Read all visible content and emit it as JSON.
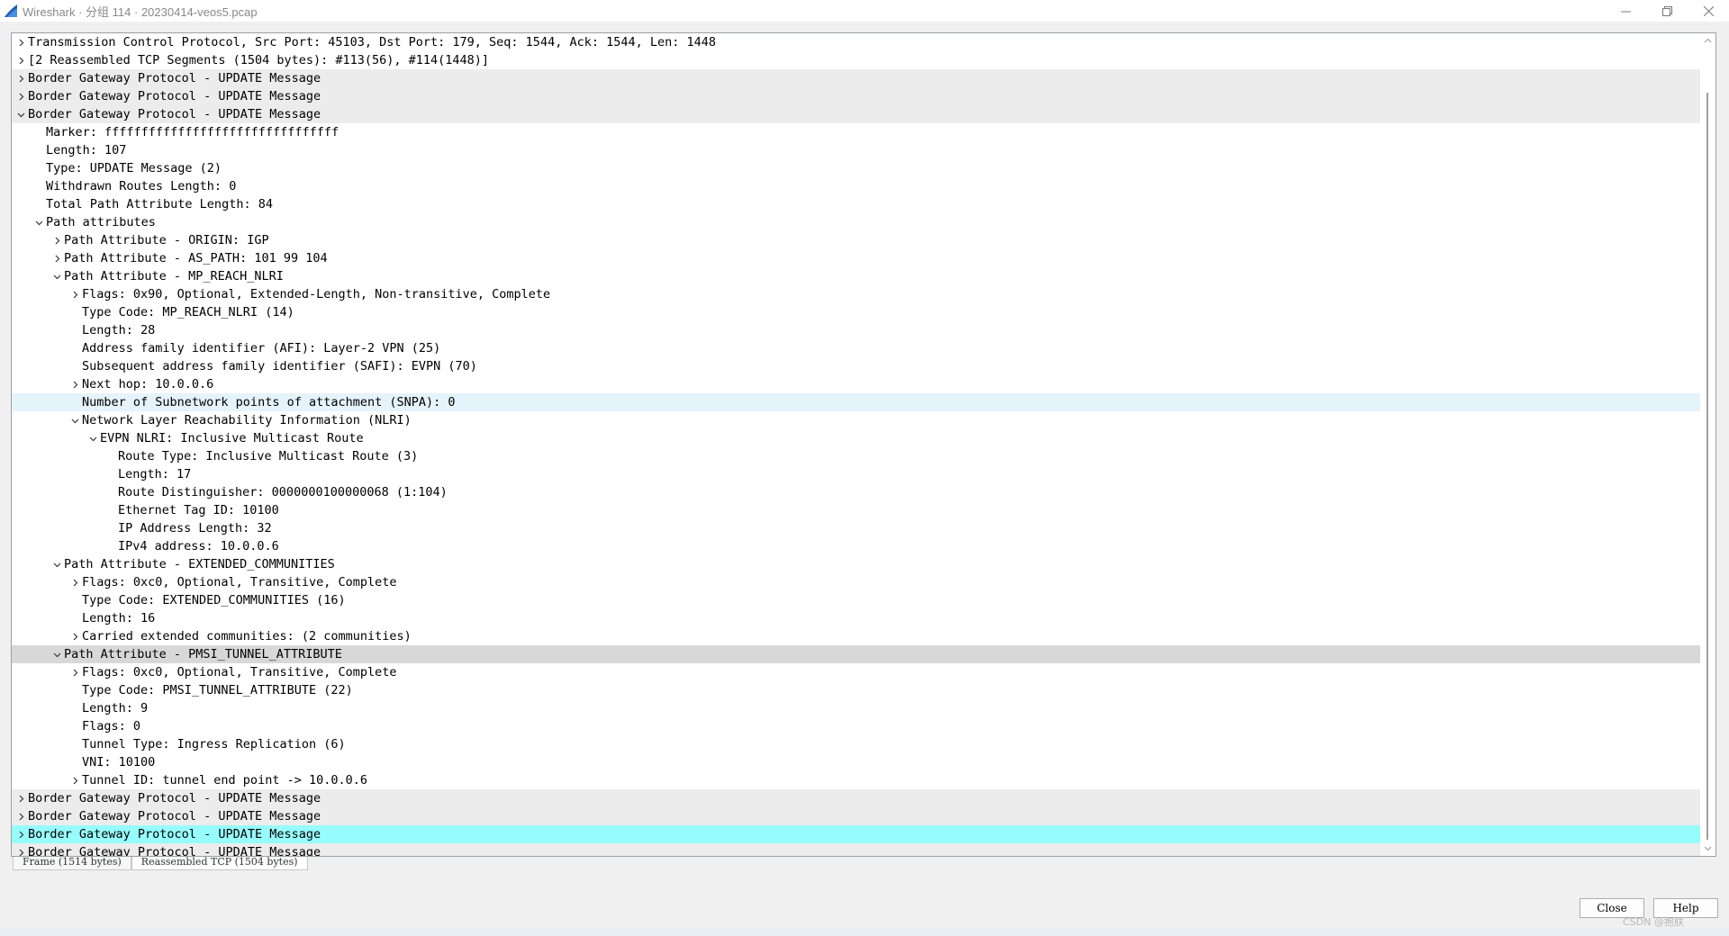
{
  "window": {
    "title": "Wireshark · 分组 114 · 20230414-veos5.pcap"
  },
  "tree": [
    {
      "level": 0,
      "expander": "collapsed",
      "text": "Transmission Control Protocol, Src Port: 45103, Dst Port: 179, Seq: 1544, Ack: 1544, Len: 1448",
      "bg": ""
    },
    {
      "level": 0,
      "expander": "collapsed",
      "text": "[2 Reassembled TCP Segments (1504 bytes): #113(56), #114(1448)]",
      "bg": ""
    },
    {
      "level": 0,
      "expander": "collapsed",
      "text": "Border Gateway Protocol - UPDATE Message",
      "bg": "grey"
    },
    {
      "level": 0,
      "expander": "collapsed",
      "text": "Border Gateway Protocol - UPDATE Message",
      "bg": "grey"
    },
    {
      "level": 0,
      "expander": "expanded",
      "text": "Border Gateway Protocol - UPDATE Message",
      "bg": "grey"
    },
    {
      "level": 1,
      "expander": "none",
      "text": "Marker: ffffffffffffffffffffffffffffffff",
      "bg": ""
    },
    {
      "level": 1,
      "expander": "none",
      "text": "Length: 107",
      "bg": ""
    },
    {
      "level": 1,
      "expander": "none",
      "text": "Type: UPDATE Message (2)",
      "bg": ""
    },
    {
      "level": 1,
      "expander": "none",
      "text": "Withdrawn Routes Length: 0",
      "bg": ""
    },
    {
      "level": 1,
      "expander": "none",
      "text": "Total Path Attribute Length: 84",
      "bg": ""
    },
    {
      "level": 1,
      "expander": "expanded",
      "text": "Path attributes",
      "bg": ""
    },
    {
      "level": 2,
      "expander": "collapsed",
      "text": "Path Attribute - ORIGIN: IGP",
      "bg": ""
    },
    {
      "level": 2,
      "expander": "collapsed",
      "text": "Path Attribute - AS_PATH: 101 99 104",
      "bg": ""
    },
    {
      "level": 2,
      "expander": "expanded",
      "text": "Path Attribute - MP_REACH_NLRI",
      "bg": ""
    },
    {
      "level": 3,
      "expander": "collapsed",
      "text": "Flags: 0x90, Optional, Extended-Length, Non-transitive, Complete",
      "bg": ""
    },
    {
      "level": 3,
      "expander": "none",
      "text": "Type Code: MP_REACH_NLRI (14)",
      "bg": ""
    },
    {
      "level": 3,
      "expander": "none",
      "text": "Length: 28",
      "bg": ""
    },
    {
      "level": 3,
      "expander": "none",
      "text": "Address family identifier (AFI): Layer-2 VPN (25)",
      "bg": ""
    },
    {
      "level": 3,
      "expander": "none",
      "text": "Subsequent address family identifier (SAFI): EVPN (70)",
      "bg": ""
    },
    {
      "level": 3,
      "expander": "collapsed",
      "text": "Next hop: 10.0.0.6",
      "bg": ""
    },
    {
      "level": 3,
      "expander": "none",
      "text": "Number of Subnetwork points of attachment (SNPA): 0",
      "bg": "hover"
    },
    {
      "level": 3,
      "expander": "expanded",
      "text": "Network Layer Reachability Information (NLRI)",
      "bg": ""
    },
    {
      "level": 4,
      "expander": "expanded",
      "text": "EVPN NLRI: Inclusive Multicast Route",
      "bg": ""
    },
    {
      "level": 5,
      "expander": "none",
      "text": "Route Type: Inclusive Multicast Route (3)",
      "bg": ""
    },
    {
      "level": 5,
      "expander": "none",
      "text": "Length: 17",
      "bg": ""
    },
    {
      "level": 5,
      "expander": "none",
      "text": "Route Distinguisher: 0000000100000068 (1:104)",
      "bg": ""
    },
    {
      "level": 5,
      "expander": "none",
      "text": "Ethernet Tag ID: 10100",
      "bg": ""
    },
    {
      "level": 5,
      "expander": "none",
      "text": "IP Address Length: 32",
      "bg": ""
    },
    {
      "level": 5,
      "expander": "none",
      "text": "IPv4 address: 10.0.0.6",
      "bg": ""
    },
    {
      "level": 2,
      "expander": "expanded",
      "text": "Path Attribute - EXTENDED_COMMUNITIES",
      "bg": ""
    },
    {
      "level": 3,
      "expander": "collapsed",
      "text": "Flags: 0xc0, Optional, Transitive, Complete",
      "bg": ""
    },
    {
      "level": 3,
      "expander": "none",
      "text": "Type Code: EXTENDED_COMMUNITIES (16)",
      "bg": ""
    },
    {
      "level": 3,
      "expander": "none",
      "text": "Length: 16",
      "bg": ""
    },
    {
      "level": 3,
      "expander": "collapsed",
      "text": "Carried extended communities: (2 communities)",
      "bg": ""
    },
    {
      "level": 2,
      "expander": "expanded",
      "text": "Path Attribute - PMSI_TUNNEL_ATTRIBUTE",
      "bg": "selected"
    },
    {
      "level": 3,
      "expander": "collapsed",
      "text": "Flags: 0xc0, Optional, Transitive, Complete",
      "bg": ""
    },
    {
      "level": 3,
      "expander": "none",
      "text": "Type Code: PMSI_TUNNEL_ATTRIBUTE (22)",
      "bg": ""
    },
    {
      "level": 3,
      "expander": "none",
      "text": "Length: 9",
      "bg": ""
    },
    {
      "level": 3,
      "expander": "none",
      "text": "Flags: 0",
      "bg": ""
    },
    {
      "level": 3,
      "expander": "none",
      "text": "Tunnel Type: Ingress Replication (6)",
      "bg": ""
    },
    {
      "level": 3,
      "expander": "none",
      "text": "VNI: 10100",
      "bg": ""
    },
    {
      "level": 3,
      "expander": "collapsed",
      "text": "Tunnel ID: tunnel end point -> 10.0.0.6",
      "bg": ""
    },
    {
      "level": 0,
      "expander": "collapsed",
      "text": "Border Gateway Protocol - UPDATE Message",
      "bg": "grey"
    },
    {
      "level": 0,
      "expander": "collapsed",
      "text": "Border Gateway Protocol - UPDATE Message",
      "bg": "grey"
    },
    {
      "level": 0,
      "expander": "collapsed",
      "text": "Border Gateway Protocol - UPDATE Message",
      "bg": "cyan"
    },
    {
      "level": 0,
      "expander": "collapsed",
      "text": "Border Gateway Protocol - UPDATE Message",
      "bg": "grey"
    }
  ],
  "tabs": [
    {
      "label": "Frame (1514 bytes)",
      "active": false
    },
    {
      "label": "Reassembled TCP (1504 bytes)",
      "active": true
    }
  ],
  "buttons": {
    "close": "Close",
    "help": "Help"
  },
  "watermark": "CSDN @抱朕",
  "icons": {
    "app": "wireshark-fin-icon",
    "expander_collapsed": "chevron-right-icon",
    "expander_expanded": "chevron-down-icon"
  }
}
